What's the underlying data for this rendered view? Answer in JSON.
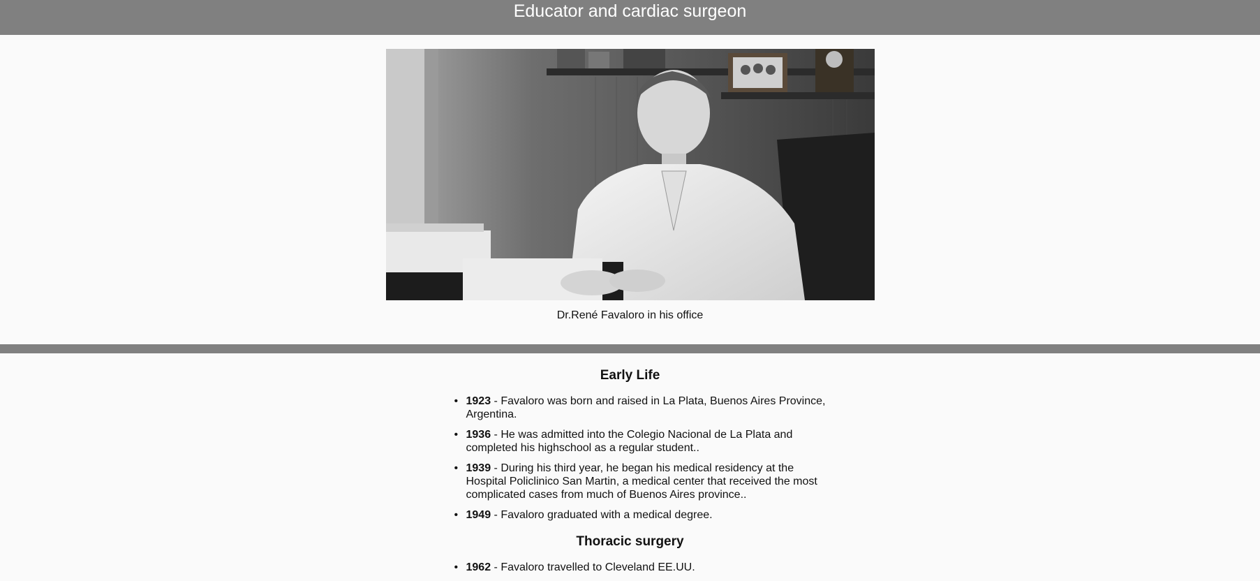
{
  "header": {
    "title": "Educator and cardiac surgeon"
  },
  "figure": {
    "caption": "Dr.René Favaloro in his office"
  },
  "sections": [
    {
      "title": "Early Life",
      "items": [
        {
          "year": "1923",
          "text": " - Favaloro was born and raised in La Plata, Buenos Aires Province, Argentina."
        },
        {
          "year": "1936",
          "text": " - He was admitted into the Colegio Nacional de La Plata and completed his highschool as a regular student.."
        },
        {
          "year": "1939",
          "text": " - During his third year, he began his medical residency at the Hospital Policlinico San Martin, a medical center that received the most complicated cases from much of Buenos Aires province.."
        },
        {
          "year": "1949",
          "text": " - Favaloro graduated with a medical degree."
        }
      ]
    },
    {
      "title": "Thoracic surgery",
      "items": [
        {
          "year": "1962",
          "text": " - Favaloro travelled to Cleveland EE.UU."
        }
      ]
    }
  ],
  "colors": {
    "header_bg": "#808080",
    "page_bg": "#fafafa"
  }
}
